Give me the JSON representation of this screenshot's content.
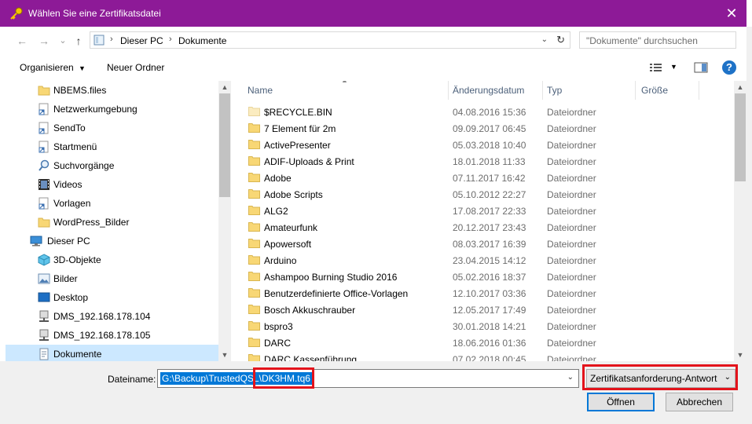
{
  "window": {
    "title": "Wählen Sie eine Zertifikatsdatei",
    "close_glyph": "✕"
  },
  "nav": {
    "back": "←",
    "forward": "→",
    "recent": "⌄",
    "up": "↑",
    "breadcrumb": [
      "Dieser PC",
      "Dokumente"
    ],
    "search_placeholder": "\"Dokumente\" durchsuchen"
  },
  "toolbar": {
    "organize": "Organisieren",
    "new_folder": "Neuer Ordner"
  },
  "sidebar": {
    "items": [
      {
        "label": "NBEMS.files",
        "icon": "folder-icon"
      },
      {
        "label": "Netzwerkumgebung",
        "icon": "shortcut-icon"
      },
      {
        "label": "SendTo",
        "icon": "shortcut-icon"
      },
      {
        "label": "Startmenü",
        "icon": "shortcut-icon"
      },
      {
        "label": "Suchvorgänge",
        "icon": "search-folder-icon"
      },
      {
        "label": "Videos",
        "icon": "videos-icon"
      },
      {
        "label": "Vorlagen",
        "icon": "shortcut-icon"
      },
      {
        "label": "WordPress_Bilder",
        "icon": "folder-icon"
      },
      {
        "label": "Dieser PC",
        "icon": "computer-icon"
      },
      {
        "label": "3D-Objekte",
        "icon": "3d-objects-icon"
      },
      {
        "label": "Bilder",
        "icon": "pictures-icon"
      },
      {
        "label": "Desktop",
        "icon": "desktop-icon"
      },
      {
        "label": "DMS_192.168.178.104",
        "icon": "network-drive-icon"
      },
      {
        "label": "DMS_192.168.178.105",
        "icon": "network-drive-icon"
      },
      {
        "label": "Dokumente",
        "icon": "documents-icon"
      }
    ]
  },
  "columns": {
    "name": "Name",
    "date": "Änderungsdatum",
    "type": "Typ",
    "size": "Größe"
  },
  "files": [
    {
      "name": "$RECYCLE.BIN",
      "date": "04.08.2016 15:36",
      "type": "Dateiordner"
    },
    {
      "name": "7 Element für 2m",
      "date": "09.09.2017 06:45",
      "type": "Dateiordner"
    },
    {
      "name": "ActivePresenter",
      "date": "05.03.2018 10:40",
      "type": "Dateiordner"
    },
    {
      "name": "ADIF-Uploads & Print",
      "date": "18.01.2018 11:33",
      "type": "Dateiordner"
    },
    {
      "name": "Adobe",
      "date": "07.11.2017 16:42",
      "type": "Dateiordner"
    },
    {
      "name": "Adobe Scripts",
      "date": "05.10.2012 22:27",
      "type": "Dateiordner"
    },
    {
      "name": "ALG2",
      "date": "17.08.2017 22:33",
      "type": "Dateiordner"
    },
    {
      "name": "Amateurfunk",
      "date": "20.12.2017 23:43",
      "type": "Dateiordner"
    },
    {
      "name": "Apowersoft",
      "date": "08.03.2017 16:39",
      "type": "Dateiordner"
    },
    {
      "name": "Arduino",
      "date": "23.04.2015 14:12",
      "type": "Dateiordner"
    },
    {
      "name": "Ashampoo Burning Studio 2016",
      "date": "05.02.2016 18:37",
      "type": "Dateiordner"
    },
    {
      "name": "Benutzerdefinierte Office-Vorlagen",
      "date": "12.10.2017 03:36",
      "type": "Dateiordner"
    },
    {
      "name": "Bosch Akkuschrauber",
      "date": "12.05.2017 17:49",
      "type": "Dateiordner"
    },
    {
      "name": "bspro3",
      "date": "30.01.2018 14:21",
      "type": "Dateiordner"
    },
    {
      "name": "DARC",
      "date": "18.06.2016 01:36",
      "type": "Dateiordner"
    },
    {
      "name": "DARC Kassenführung",
      "date": "07.02.2018 00:45",
      "type": "Dateiordner"
    }
  ],
  "footer": {
    "filename_label": "Dateiname:",
    "filename_value": "G:\\Backup\\TrustedQSL\\DK3HM.tq6",
    "filetype_value": "Zertifikatsanforderung-Antwort",
    "open_button": "Öffnen",
    "cancel_button": "Abbrechen"
  },
  "colors": {
    "titlebar": "#8d1a97",
    "selection": "#0078d7",
    "highlight_box": "#e3131b",
    "folder": "#f8d775"
  }
}
